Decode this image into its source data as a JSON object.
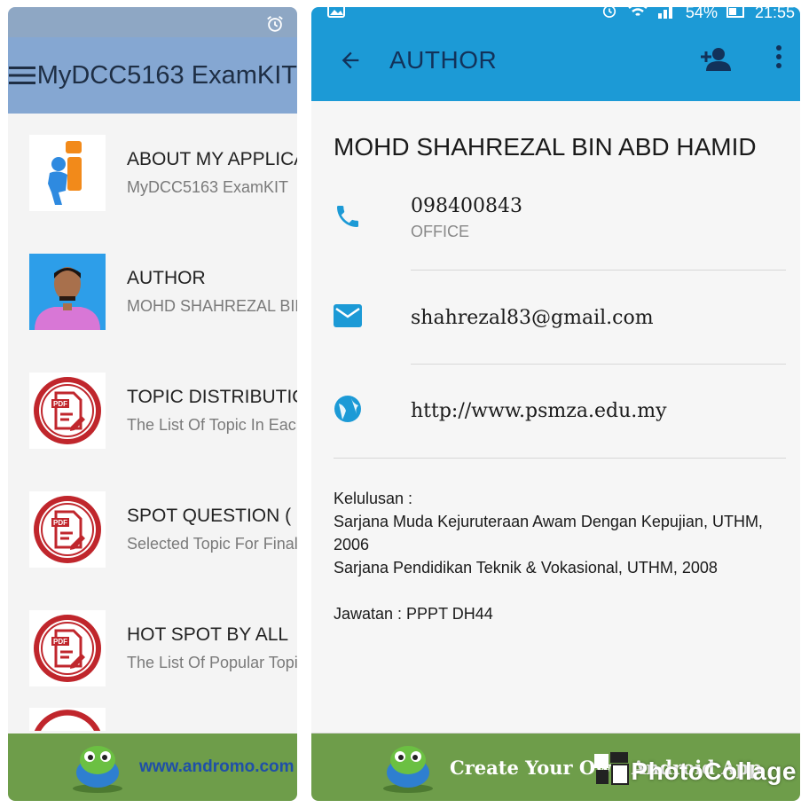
{
  "left": {
    "app_title": "MyDCC5163 ExamKIT",
    "items": [
      {
        "title": "ABOUT MY APPLICATION",
        "subtitle": "MyDCC5163 ExamKIT",
        "icon": "info-person-icon"
      },
      {
        "title": "AUTHOR",
        "subtitle": "MOHD SHAHREZAL BIN ABD HAMID",
        "icon": "author-photo"
      },
      {
        "title": "TOPIC DISTRIBUTION",
        "subtitle": "The List Of Topic In Each Question",
        "icon": "pdf-icon"
      },
      {
        "title": "SPOT QUESTION (",
        "subtitle": "Selected Topic For Final Exam",
        "icon": "pdf-icon"
      },
      {
        "title": "HOT SPOT BY ALL",
        "subtitle": "The List Of Popular Topic",
        "icon": "pdf-icon"
      }
    ],
    "ad_text": "www.andromo.com"
  },
  "right": {
    "status": {
      "battery": "54%",
      "time": "21:55"
    },
    "title": "AUTHOR",
    "name": "MOHD SHAHREZAL BIN ABD HAMID",
    "phone": {
      "value": "098400843",
      "label": "OFFICE"
    },
    "email": "shahrezal83@gmail.com",
    "website": "http://www.psmza.edu.my",
    "about": {
      "line1": "Kelulusan :",
      "line2": "Sarjana Muda Kejuruteraan Awam Dengan Kepujian, UTHM, 2006",
      "line3": "Sarjana Pendidikan Teknik & Vokasional, UTHM, 2008",
      "line4": "Jawatan : PPPT DH44"
    },
    "ad_text": "Create Your Own Android App"
  },
  "watermark": "PhotoCollage",
  "colors": {
    "left_appbar": "#85a7d2",
    "right_appbar": "#1c9ad6",
    "ad_green": "#6e9d4a",
    "icon_blue": "#1c9ad6",
    "pdf_red": "#c0262c"
  }
}
